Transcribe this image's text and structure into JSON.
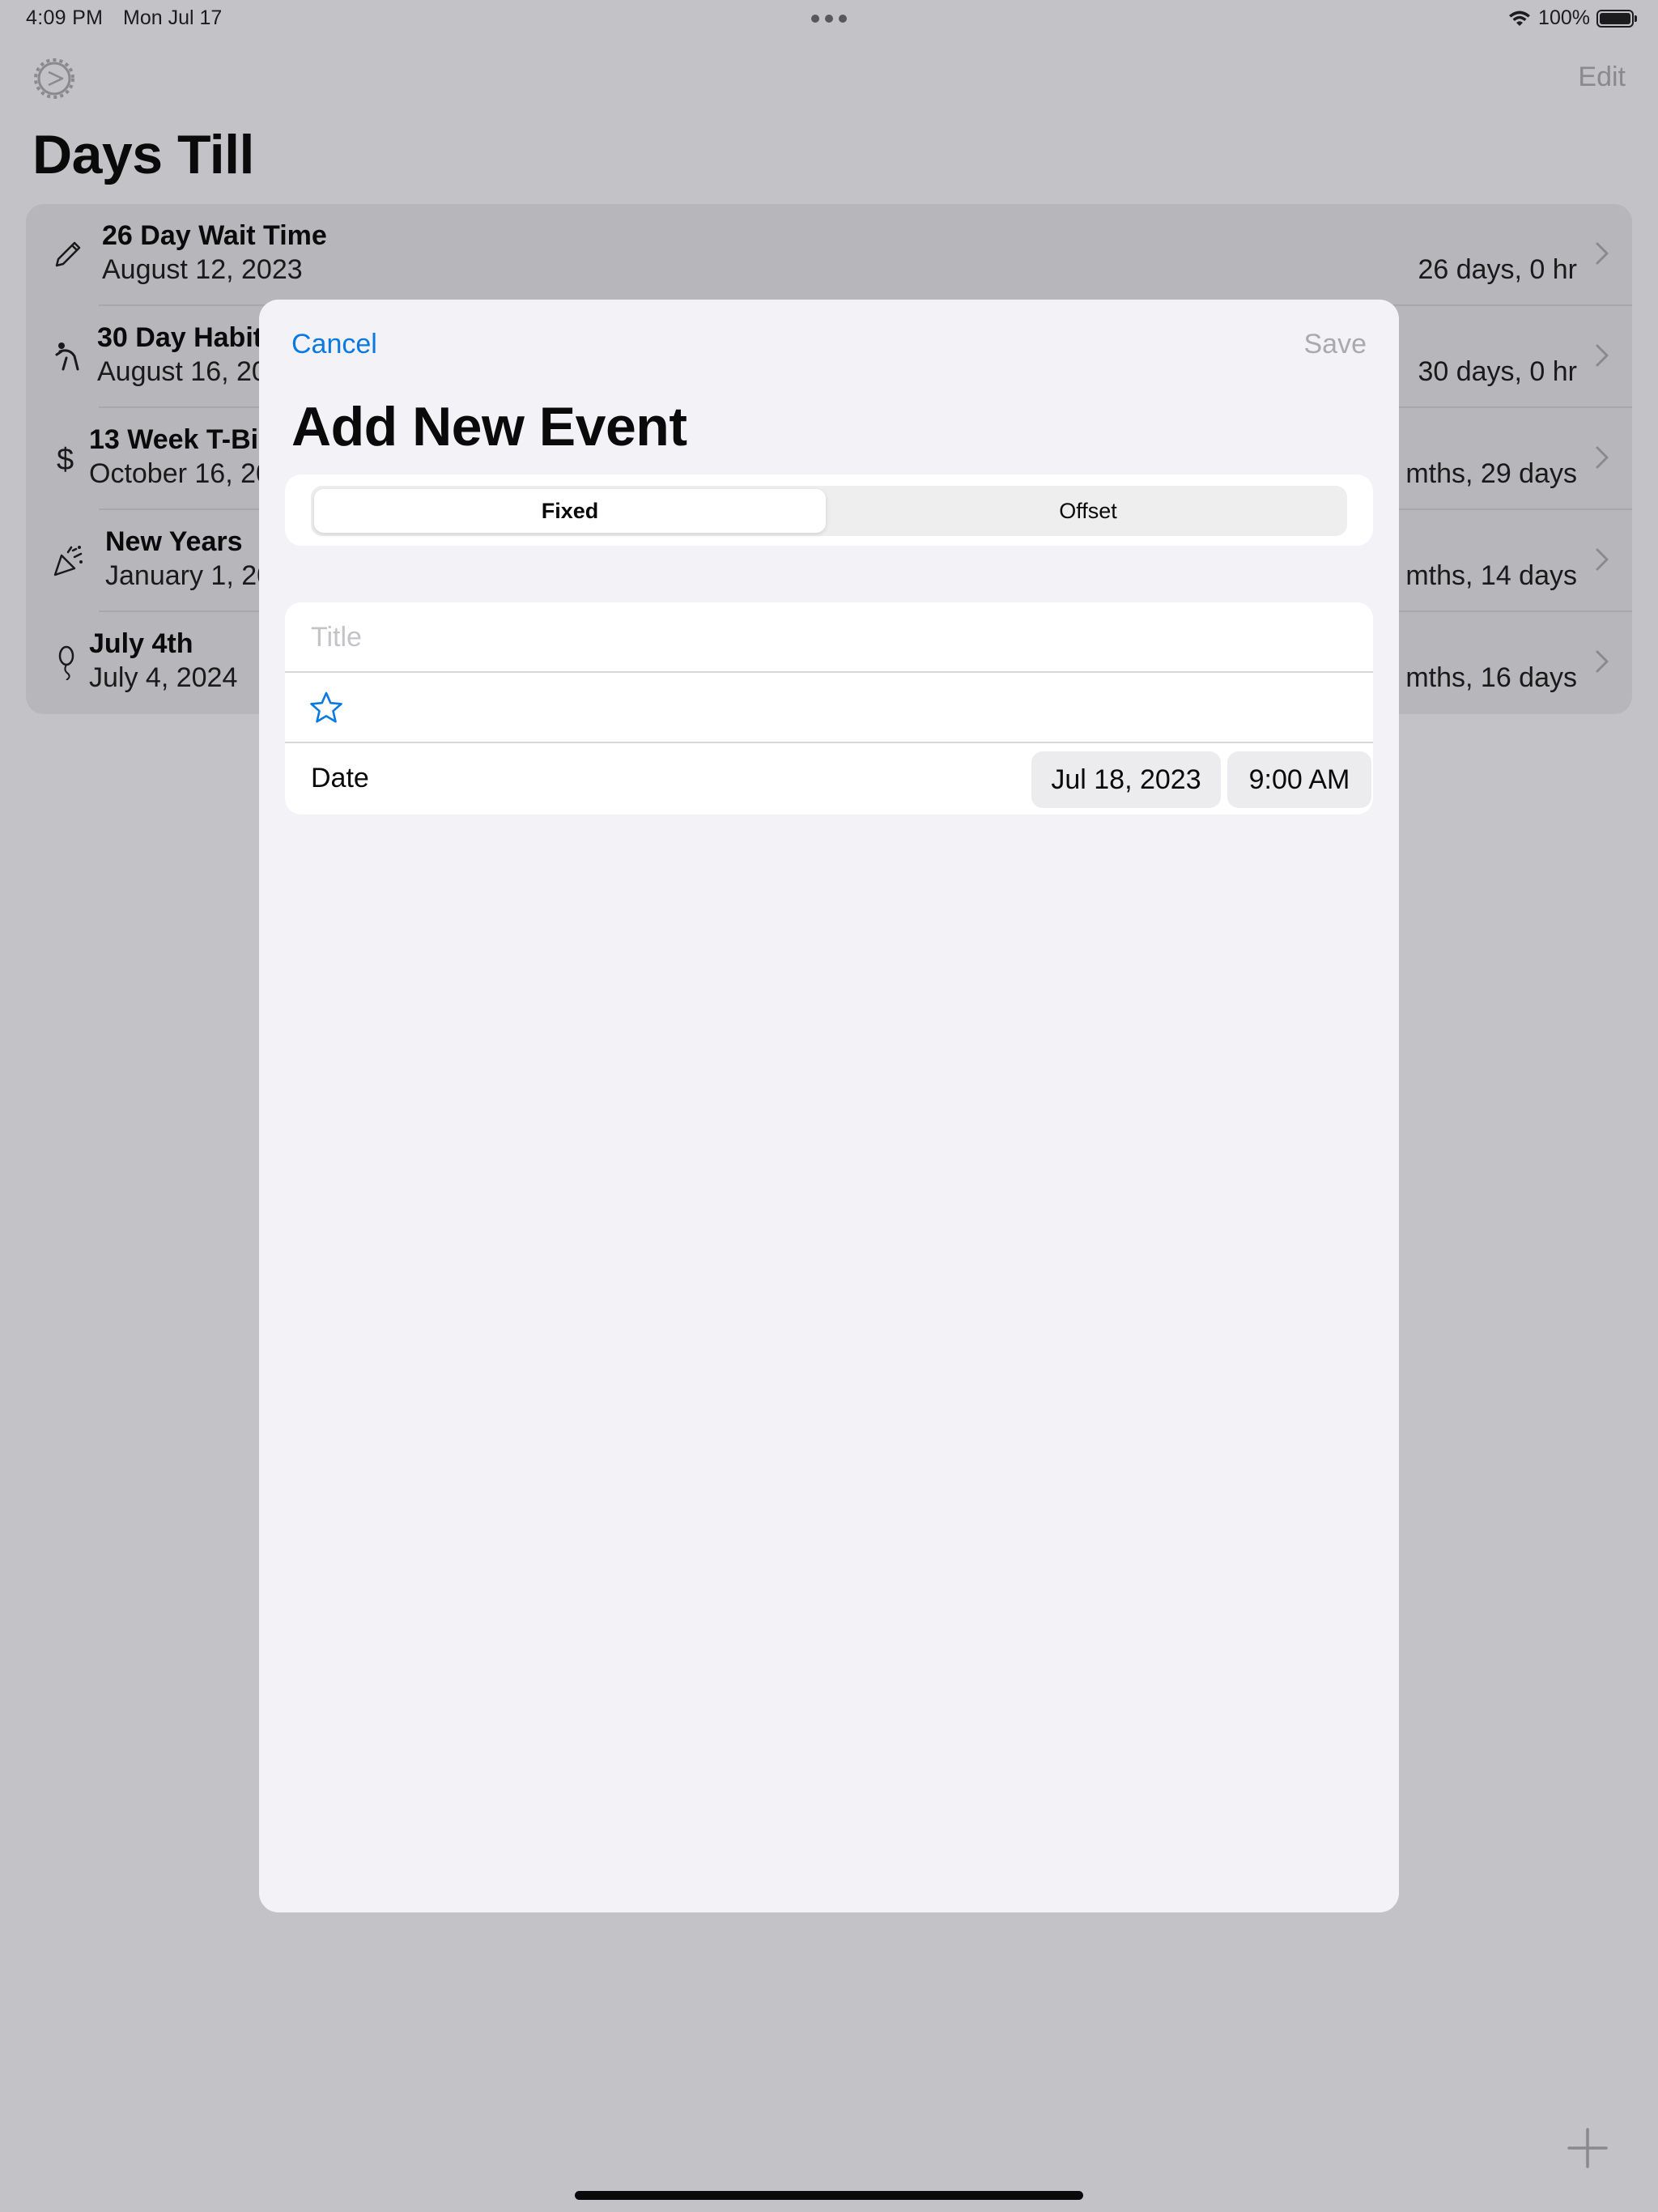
{
  "status_bar": {
    "time": "4:09 PM",
    "date": "Mon Jul 17",
    "battery": "100%"
  },
  "background": {
    "edit_label": "Edit",
    "title": "Days Till",
    "events": [
      {
        "icon": "pencil-icon",
        "title": "26 Day Wait Time",
        "date": "August 12, 2023",
        "remaining": "26 days, 0 hr"
      },
      {
        "icon": "figure-swim-icon",
        "title": "30 Day Habit",
        "date": "August 16, 20",
        "remaining": "30 days, 0 hr"
      },
      {
        "icon": "dollar-icon",
        "title": "13 Week T-Bil",
        "date": "October 16, 20",
        "remaining": "mths, 29 days"
      },
      {
        "icon": "party-popper-icon",
        "title": "New Years",
        "date": "January 1, 20",
        "remaining": "mths, 14 days"
      },
      {
        "icon": "balloon-icon",
        "title": "July 4th",
        "date": "July 4, 2024",
        "remaining": "mths, 16 days"
      }
    ]
  },
  "sheet": {
    "cancel_label": "Cancel",
    "save_label": "Save",
    "title": "Add New Event",
    "segments": [
      "Fixed",
      "Offset"
    ],
    "selected_segment": "Fixed",
    "title_placeholder": "Title",
    "title_value": "",
    "star_icon": "star-icon",
    "date_label": "Date",
    "date_value": "Jul 18, 2023",
    "time_value": "9:00 AM"
  },
  "colors": {
    "accent": "#0a7ae0",
    "dim_background": "#c2c2c7",
    "sheet_background": "#f2f2f7"
  }
}
